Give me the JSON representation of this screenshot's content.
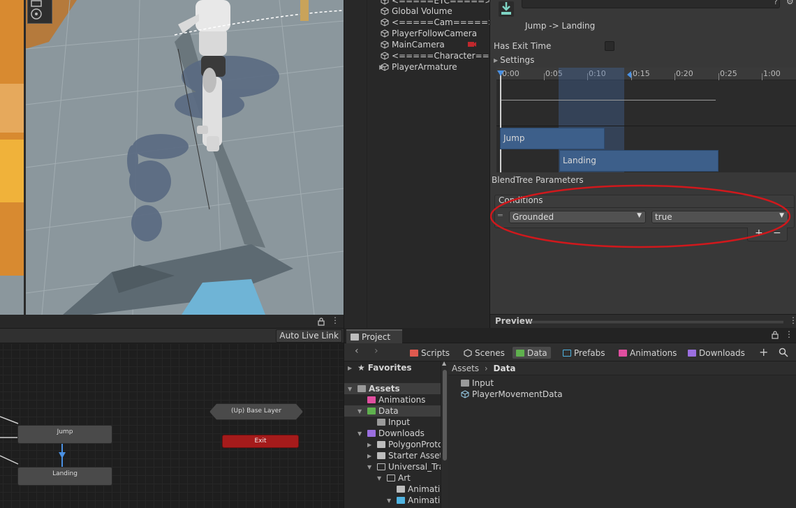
{
  "hierarchy": {
    "items": [
      {
        "label": "<=====ETC=====>"
      },
      {
        "label": "Global Volume"
      },
      {
        "label": "<=====Cam=====>"
      },
      {
        "label": "PlayerFollowCamera"
      },
      {
        "label": "MainCamera"
      },
      {
        "label": "<=====Character===="
      },
      {
        "label": "PlayerArmature"
      }
    ]
  },
  "inspector": {
    "transition_title": "Jump -> Landing",
    "has_exit_time_label": "Has Exit Time",
    "settings_label": "Settings",
    "ruler_ticks": [
      "0:00",
      "0:05",
      "0:10",
      "0:15",
      "0:20",
      "0:25",
      "1:00"
    ],
    "clip_from": "Jump",
    "clip_to": "Landing",
    "blendtree_label": "BlendTree Parameters",
    "conditions_label": "Conditions",
    "condition": {
      "parameter": "Grounded",
      "value": "true"
    },
    "add_label": "+",
    "remove_label": "−",
    "preview_label": "Preview",
    "annotation_color": "#d0181c"
  },
  "animator": {
    "auto_live_link": "Auto Live Link",
    "states": {
      "base_layer": "(Up) Base Layer",
      "exit": "Exit",
      "jump": "Jump",
      "landing": "Landing"
    },
    "transition_color": "#4a90e2"
  },
  "project": {
    "tab_label": "Project",
    "favorites_bar": [
      {
        "label": "Scripts",
        "color": "#e05a4f"
      },
      {
        "label": "Scenes",
        "color": "#cfcfcf"
      },
      {
        "label": "Data",
        "color": "#5fb14e"
      },
      {
        "label": "Prefabs",
        "color": "#4fb3e0"
      },
      {
        "label": "Animations",
        "color": "#e04fa0"
      },
      {
        "label": "Downloads",
        "color": "#9b6fe0"
      }
    ],
    "add_label": "+",
    "tree": {
      "favorites": "Favorites",
      "assets": "Assets",
      "animations": "Animations",
      "data": "Data",
      "input": "Input",
      "downloads": "Downloads",
      "polygon": "PolygonProto",
      "starter": "Starter Asset",
      "universal": "Universal_Tra",
      "art": "Art",
      "animations2": "Animatio",
      "animations3": "Animatio"
    },
    "breadcrumb": {
      "root": "Assets",
      "current": "Data"
    },
    "files": [
      "Input",
      "PlayerMovementData"
    ]
  }
}
